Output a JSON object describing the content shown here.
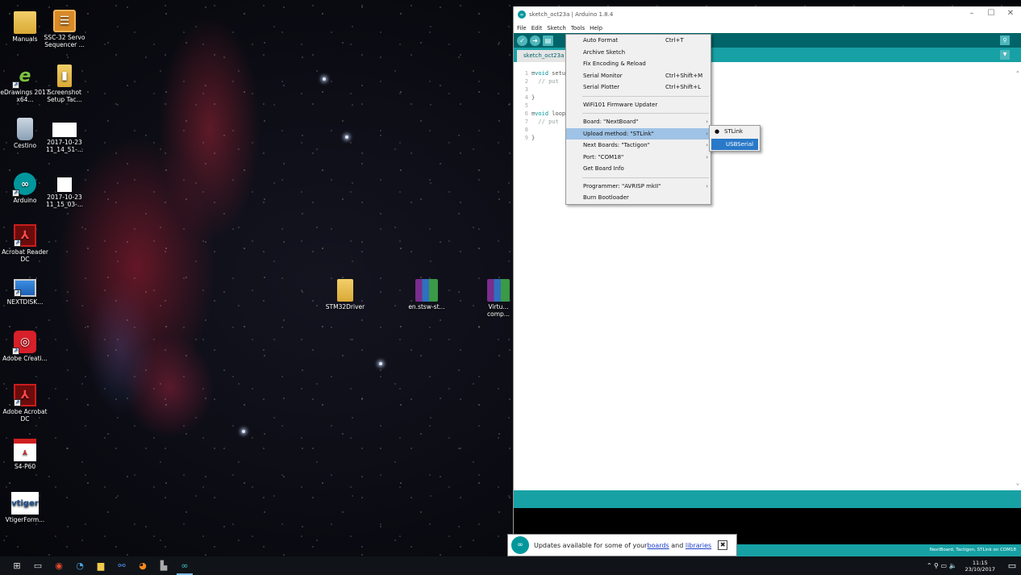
{
  "desktop": {
    "icons_left": [
      {
        "label": "Manuals",
        "icon": "folder-icon"
      },
      {
        "label": "SSC-32 Servo Sequencer ...",
        "icon": "servo-app-icon"
      },
      {
        "label": "eDrawings 2017 x64...",
        "icon": "edrawings-icon",
        "badge": "2017"
      },
      {
        "label": "Screenshot Setup Tac...",
        "icon": "screenshot-icon"
      },
      {
        "label": "Cestino",
        "icon": "recycle-bin-icon"
      },
      {
        "label": "2017-10-23 11_14_51-...",
        "icon": "image-file-icon"
      },
      {
        "label": "Arduino",
        "icon": "arduino-icon"
      },
      {
        "label": "2017-10-23 11_15_03-...",
        "icon": "image-file-icon"
      },
      {
        "label": "Acrobat Reader DC",
        "icon": "acrobat-icon"
      },
      {
        "label": "NEXTDISK...",
        "icon": "monitor-icon"
      },
      {
        "label": "Adobe Creati...",
        "icon": "adobe-cc-icon"
      },
      {
        "label": "Adobe Acrobat DC",
        "icon": "acrobat-icon"
      },
      {
        "label": "S4-P60",
        "icon": "pdf-icon"
      },
      {
        "label": "VtigerForm...",
        "icon": "vtiger-icon",
        "glyph": "vtiger"
      }
    ],
    "icons_middle": [
      {
        "label": "STM32Driver",
        "icon": "folder-icon"
      },
      {
        "label": "en.stsw-st...",
        "icon": "winrar-icon"
      },
      {
        "label": "Virtu... comp...",
        "icon": "winrar-icon"
      }
    ]
  },
  "arduino": {
    "title": "sketch_oct23a | Arduino 1.8.4",
    "menubar": [
      "File",
      "Edit",
      "Sketch",
      "Tools",
      "Help"
    ],
    "tab": "sketch_oct23a",
    "code": [
      {
        "ln": "1",
        "fold": "⊟",
        "kw": "void",
        "text": " setu"
      },
      {
        "ln": "2",
        "fold": "",
        "kw": "",
        "text": "  // put"
      },
      {
        "ln": "3",
        "fold": "",
        "kw": "",
        "text": ""
      },
      {
        "ln": "4",
        "fold": "",
        "kw": "",
        "text": "}"
      },
      {
        "ln": "5",
        "fold": "",
        "kw": "",
        "text": ""
      },
      {
        "ln": "6",
        "fold": "⊟",
        "kw": "void",
        "text": " loop"
      },
      {
        "ln": "7",
        "fold": "",
        "kw": "",
        "text": "  // put"
      },
      {
        "ln": "8",
        "fold": "",
        "kw": "",
        "text": ""
      },
      {
        "ln": "9",
        "fold": "",
        "kw": "",
        "text": "}"
      }
    ],
    "status": "NextBoard, Tactigon, STLink on COM18"
  },
  "tools_menu": {
    "group1": [
      {
        "label": "Auto Format",
        "shortcut": "Ctrl+T"
      },
      {
        "label": "Archive Sketch",
        "shortcut": ""
      },
      {
        "label": "Fix Encoding & Reload",
        "shortcut": ""
      },
      {
        "label": "Serial Monitor",
        "shortcut": "Ctrl+Shift+M"
      },
      {
        "label": "Serial Plotter",
        "shortcut": "Ctrl+Shift+L"
      }
    ],
    "group2": [
      {
        "label": "WiFi101 Firmware Updater"
      }
    ],
    "group3": [
      {
        "label": "Board: \"NextBoard\"",
        "submenu": true
      },
      {
        "label": "Upload method: \"STLink\"",
        "submenu": true,
        "highlighted": true
      },
      {
        "label": "Next Boards: \"Tactigon\"",
        "submenu": true
      },
      {
        "label": "Port: \"COM18\"",
        "submenu": true
      },
      {
        "label": "Get Board Info",
        "submenu": false
      }
    ],
    "group4": [
      {
        "label": "Programmer: \"AVRISP mkII\"",
        "submenu": true
      },
      {
        "label": "Burn Bootloader",
        "submenu": false
      }
    ]
  },
  "upload_submenu": {
    "items": [
      {
        "label": "STLink",
        "selected": true
      },
      {
        "label": "USBSerial",
        "selected": false,
        "hover": true
      }
    ]
  },
  "notification": {
    "text_before": "Updates available for some of your ",
    "link1": "boards",
    "text_middle": " and ",
    "link2": "libraries",
    "close": "✖"
  },
  "taskbar": {
    "clock_time": "11:15",
    "clock_date": "23/10/2017",
    "tray_symbols": "⌃  ⚲  ▭  🔈"
  }
}
